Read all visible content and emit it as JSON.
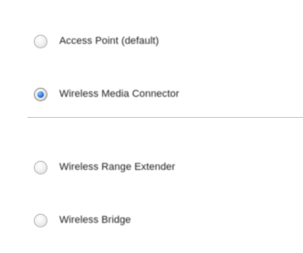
{
  "mode_options": [
    {
      "label": "Access Point (default)",
      "selected": false
    },
    {
      "label": "Wireless Media Connector",
      "selected": true
    },
    {
      "label": "Wireless Range Extender",
      "selected": false
    },
    {
      "label": "Wireless Bridge",
      "selected": false
    }
  ],
  "colors": {
    "radio_selected": "#2b7de0",
    "divider": "#c9cce0",
    "text": "#1a1a1a"
  }
}
